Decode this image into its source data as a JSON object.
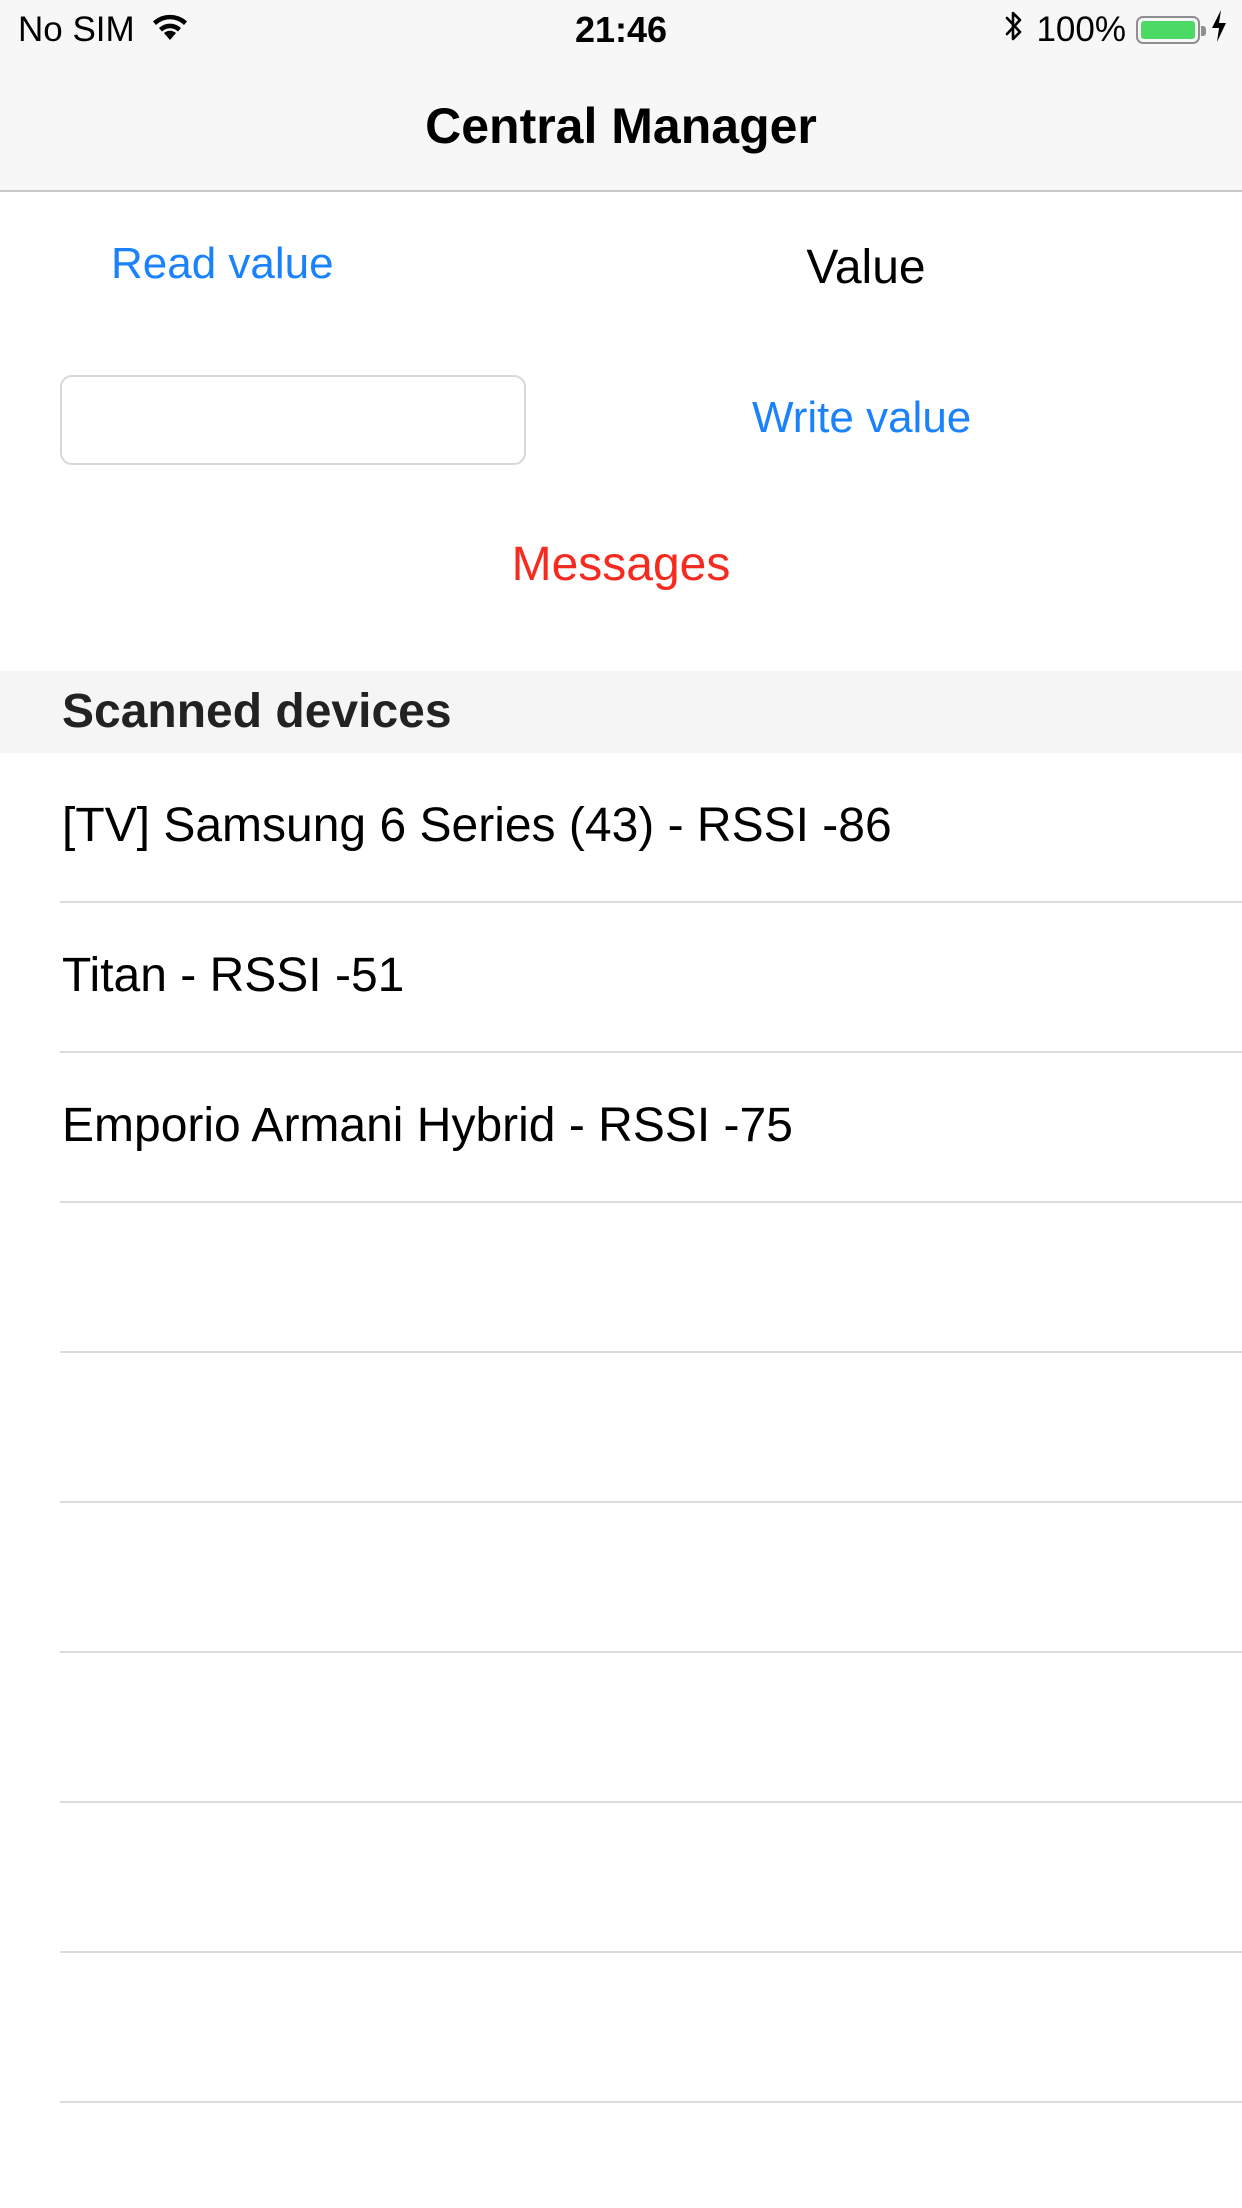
{
  "status_bar": {
    "carrier": "No SIM",
    "time": "21:46",
    "battery_percent": "100%",
    "battery_level": 1.0,
    "battery_color": "#4cd964",
    "icons": [
      "wifi-icon",
      "bluetooth-icon",
      "battery-icon",
      "charging-bolt-icon"
    ]
  },
  "nav": {
    "title": "Central Manager"
  },
  "controls": {
    "read_button_label": "Read value",
    "value_label": "Value",
    "write_input_value": "",
    "write_input_placeholder": "",
    "write_button_label": "Write value",
    "messages_label": "Messages"
  },
  "colors": {
    "accent": "#1a82fb",
    "messages": "#f62a1f"
  },
  "devices": {
    "header": "Scanned devices",
    "items": [
      {
        "label": "[TV] Samsung 6 Series (43) - RSSI -86"
      },
      {
        "label": "Titan - RSSI -51"
      },
      {
        "label": "Emporio Armani Hybrid - RSSI -75"
      },
      {
        "label": ""
      },
      {
        "label": ""
      },
      {
        "label": ""
      },
      {
        "label": ""
      },
      {
        "label": ""
      },
      {
        "label": ""
      }
    ]
  }
}
